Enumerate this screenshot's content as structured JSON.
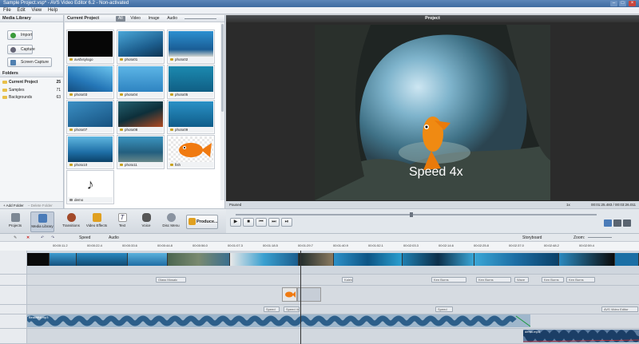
{
  "window": {
    "title": "Sample Project.vsp* - AVS Video Editor 6.2 - Non-activated",
    "controls": [
      "–",
      "□",
      "×"
    ]
  },
  "menu": [
    "File",
    "Edit",
    "View",
    "Help"
  ],
  "social_icons": [
    "facebook-icon",
    "twitter-icon",
    "vk-icon",
    "youtube-icon",
    "google-icon",
    "rss-icon"
  ],
  "media_library": {
    "title": "Media Library",
    "buttons": [
      "Import",
      "Capture",
      "Screen Capture"
    ],
    "folders_title": "Folders",
    "folders": [
      {
        "name": "Current Project",
        "count": "25",
        "bold": true
      },
      {
        "name": "Samples",
        "count": "71",
        "bold": false
      },
      {
        "name": "Backgrounds",
        "count": "63",
        "bold": false
      }
    ],
    "add_folder": "+ Add Folder",
    "delete_folder": "– Delete Folder"
  },
  "current_project": {
    "title": "Current Project",
    "tabs": [
      "All",
      "Video",
      "Image",
      "Audio"
    ],
    "items": [
      "avsfxsylogo",
      "photo01",
      "photo02",
      "photo03",
      "photo04",
      "photo05",
      "photo07",
      "photo08",
      "photo09",
      "photo10",
      "photo11",
      "fish",
      "demo"
    ]
  },
  "preview": {
    "title": "Project",
    "overlay_text": "Speed 4x",
    "status": "Paused",
    "speed": "1x",
    "time": "00:01:25.483 / 00:03:26.011"
  },
  "toolbar": {
    "tools": [
      "Projects",
      "Media Library",
      "Transitions",
      "Video Effects",
      "Text",
      "Voice",
      "Disc Menu"
    ],
    "produce": "Produce..."
  },
  "timeline": {
    "speed": "Speed",
    "audio": "Audio",
    "storyboard": "Storyboard",
    "zoom": "Zoom:",
    "ticks": [
      "00:00:11.2",
      "00:00:22.4",
      "00:00:33.6",
      "00:00:44.8",
      "00:00:56.0",
      "00:01:07.3",
      "00:01:18.5",
      "00:01:29.7",
      "00:01:40.9",
      "00:01:52.1",
      "00:02:03.3",
      "00:02:14.6",
      "00:02:25.8",
      "00:02:37.0",
      "00:02:48.2",
      "00:02:59.4"
    ],
    "effect_clips": [
      "Glass Mosaic",
      "Kaleidoscope",
      "Ken Burns",
      "Ken Burns",
      "Wave",
      "Ken Burns",
      "Ken Burns"
    ],
    "text_clips": [
      "Speed",
      "Speed 4x",
      "Speed",
      "AVS Video Editor"
    ],
    "audio_clips": [
      "Beautiful.mp3",
      "demo.mp3"
    ]
  }
}
